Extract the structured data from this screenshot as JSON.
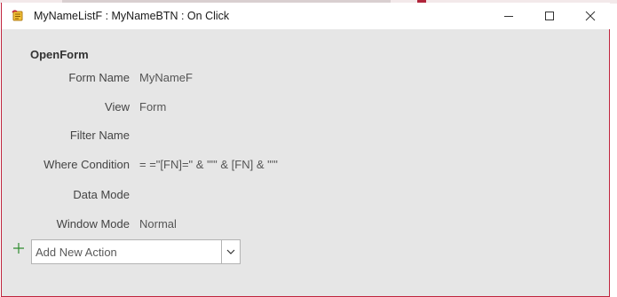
{
  "window": {
    "title": "MyNameListF : MyNameBTN : On Click",
    "accent_color": "#c0243d",
    "buttons": [
      "minimize-icon",
      "maximize-icon",
      "close-icon"
    ]
  },
  "action": {
    "name": "OpenForm",
    "arguments": [
      {
        "label": "Form Name",
        "value": "MyNameF"
      },
      {
        "label": "View",
        "value": "Form"
      },
      {
        "label": "Filter Name",
        "value": ""
      },
      {
        "label": "Where Condition",
        "value": "= =\"[FN]=\" & \"'\" & [FN] & \"'\""
      },
      {
        "label": "Data Mode",
        "value": ""
      },
      {
        "label": "Window Mode",
        "value": "Normal"
      }
    ]
  },
  "add_action": {
    "placeholder": "Add New Action",
    "plus_color": "#2e8b2e",
    "icon": "plus-icon"
  }
}
